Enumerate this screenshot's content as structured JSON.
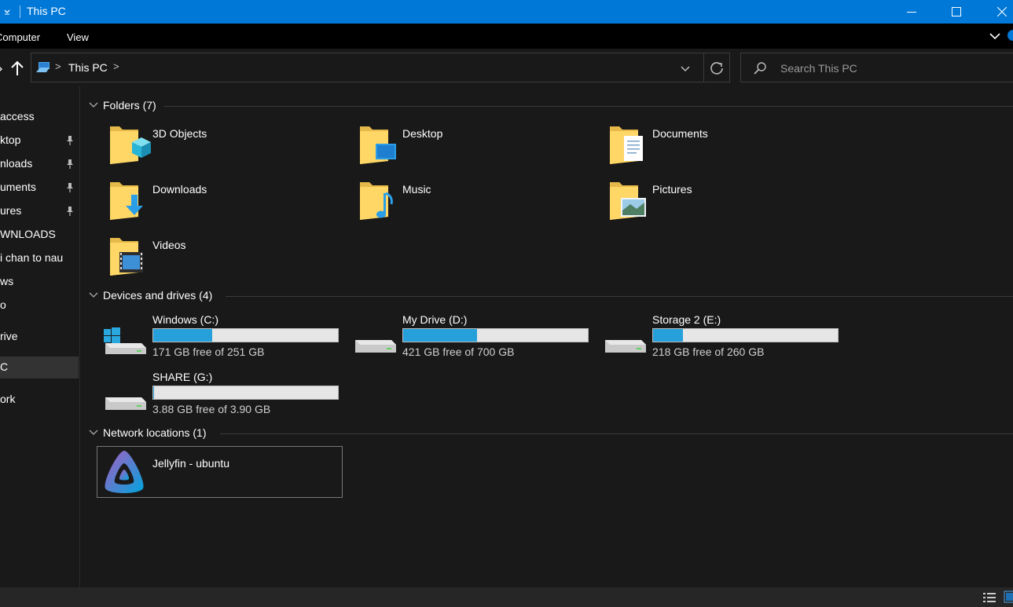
{
  "window": {
    "title": "This PC"
  },
  "ribbon": {
    "tabs": [
      "Computer",
      "View"
    ]
  },
  "address": {
    "crumb": "This PC",
    "chevron": ">"
  },
  "search": {
    "placeholder": "Search This PC"
  },
  "sidebar": {
    "items": [
      {
        "label": "Quick access",
        "visible_text": "access",
        "pinned": false
      },
      {
        "label": "Desktop",
        "visible_text": "ktop",
        "pinned": true
      },
      {
        "label": "Downloads",
        "visible_text": "nloads",
        "pinned": true
      },
      {
        "label": "Documents",
        "visible_text": "uments",
        "pinned": true
      },
      {
        "label": "Pictures",
        "visible_text": "ures",
        "pinned": true
      },
      {
        "label": "DOWNLOADS",
        "visible_text": "WNLOADS",
        "pinned": false
      },
      {
        "label": "chan to nau",
        "visible_text": "i chan to nau",
        "pinned": false
      },
      {
        "label": "Windows",
        "visible_text": "ws",
        "pinned": false
      },
      {
        "label": "Videos",
        "visible_text": "o",
        "pinned": false
      },
      {
        "label": "OneDrive",
        "visible_text": "rive",
        "pinned": false
      },
      {
        "label": "This PC",
        "visible_text": "C",
        "pinned": false,
        "selected": true
      },
      {
        "label": "Network",
        "visible_text": "ork",
        "pinned": false
      }
    ]
  },
  "groups": {
    "folders": {
      "title": "Folders (7)"
    },
    "drives": {
      "title": "Devices and drives (4)"
    },
    "network": {
      "title": "Network locations (1)"
    }
  },
  "folders": [
    {
      "name": "3D Objects",
      "icon": "3d-objects-folder-icon"
    },
    {
      "name": "Desktop",
      "icon": "desktop-folder-icon"
    },
    {
      "name": "Documents",
      "icon": "documents-folder-icon"
    },
    {
      "name": "Downloads",
      "icon": "downloads-folder-icon"
    },
    {
      "name": "Music",
      "icon": "music-folder-icon"
    },
    {
      "name": "Pictures",
      "icon": "pictures-folder-icon"
    },
    {
      "name": "Videos",
      "icon": "videos-folder-icon"
    }
  ],
  "drives": [
    {
      "name": "Windows (C:)",
      "info": "171 GB free of 251 GB",
      "used_fraction": 0.32,
      "icon": "windows-drive-icon"
    },
    {
      "name": "My Drive (D:)",
      "info": "421 GB free of 700 GB",
      "used_fraction": 0.4,
      "icon": "hard-drive-icon"
    },
    {
      "name": "Storage 2 (E:)",
      "info": "218 GB free of 260 GB",
      "used_fraction": 0.16,
      "icon": "hard-drive-icon"
    },
    {
      "name": "SHARE (G:)",
      "info": "3.88 GB free of 3.90 GB",
      "used_fraction": 0.005,
      "icon": "hard-drive-icon"
    }
  ],
  "network_locations": [
    {
      "name": "Jellyfin - ubuntu",
      "icon": "jellyfin-icon"
    }
  ],
  "colors": {
    "accent": "#0078d7",
    "drive_fill": "#26a0da",
    "background": "#191919"
  }
}
